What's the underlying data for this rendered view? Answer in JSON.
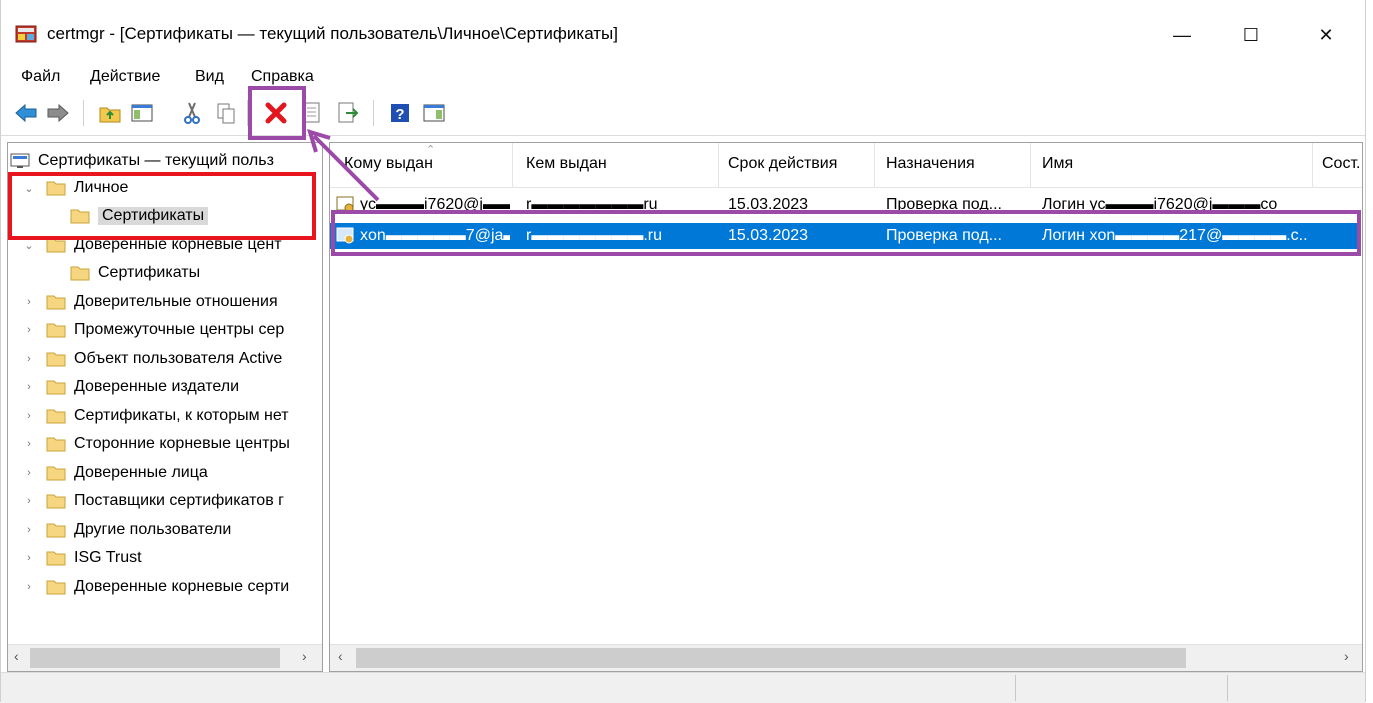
{
  "window": {
    "title": "certmgr - [Сертификаты — текущий пользователь\\Личное\\Сертификаты]",
    "minimize": "—",
    "maximize": "☐",
    "close": "✕"
  },
  "menu": [
    "Файл",
    "Действие",
    "Вид",
    "Справка"
  ],
  "tree": {
    "root": "Сертификаты — текущий польз",
    "items": [
      {
        "label": "Личное",
        "caret": "⌄"
      },
      {
        "label": "Сертификаты",
        "caret": ""
      },
      {
        "label": "Доверенные корневые цент",
        "caret": "⌄"
      },
      {
        "label": "Сертификаты",
        "caret": ""
      },
      {
        "label": "Доверительные отношения",
        "caret": "›"
      },
      {
        "label": "Промежуточные центры сер",
        "caret": "›"
      },
      {
        "label": "Объект пользователя Active",
        "caret": "›"
      },
      {
        "label": "Доверенные издатели",
        "caret": "›"
      },
      {
        "label": "Сертификаты, к которым нет",
        "caret": "›"
      },
      {
        "label": "Сторонние корневые центры",
        "caret": "›"
      },
      {
        "label": "Доверенные лица",
        "caret": "›"
      },
      {
        "label": "Поставщики сертификатов г",
        "caret": "›"
      },
      {
        "label": "Другие пользователи",
        "caret": "›"
      },
      {
        "label": "ISG Trust",
        "caret": "›"
      },
      {
        "label": "Доверенные корневые серти",
        "caret": "›"
      }
    ]
  },
  "list": {
    "columns": [
      "Кому выдан",
      "Кем выдан",
      "Срок действия",
      "Назначения",
      "Имя",
      "Сост."
    ],
    "rows": [
      {
        "issued_to": "yc▬▬▬i7620@j▬▬",
        "issued_by": "r▬▬▬▬▬▬▬ru",
        "expires": "15.03.2023",
        "purpose": "Проверка под...",
        "name": "Логин yc▬▬▬i7620@j▬▬▬co"
      },
      {
        "issued_to": "xon▬▬▬▬▬7@ja▬",
        "issued_by": "r▬▬▬▬▬▬▬.ru",
        "expires": "15.03.2023",
        "purpose": "Проверка под...",
        "name": "Логин xon▬▬▬▬217@▬▬▬▬.c..."
      }
    ]
  },
  "scroll": {
    "left": "‹",
    "right": "›"
  },
  "colors": {
    "selection": "#0078d7",
    "highlight_red": "#e8141e",
    "highlight_purple": "#9b4aa8"
  }
}
